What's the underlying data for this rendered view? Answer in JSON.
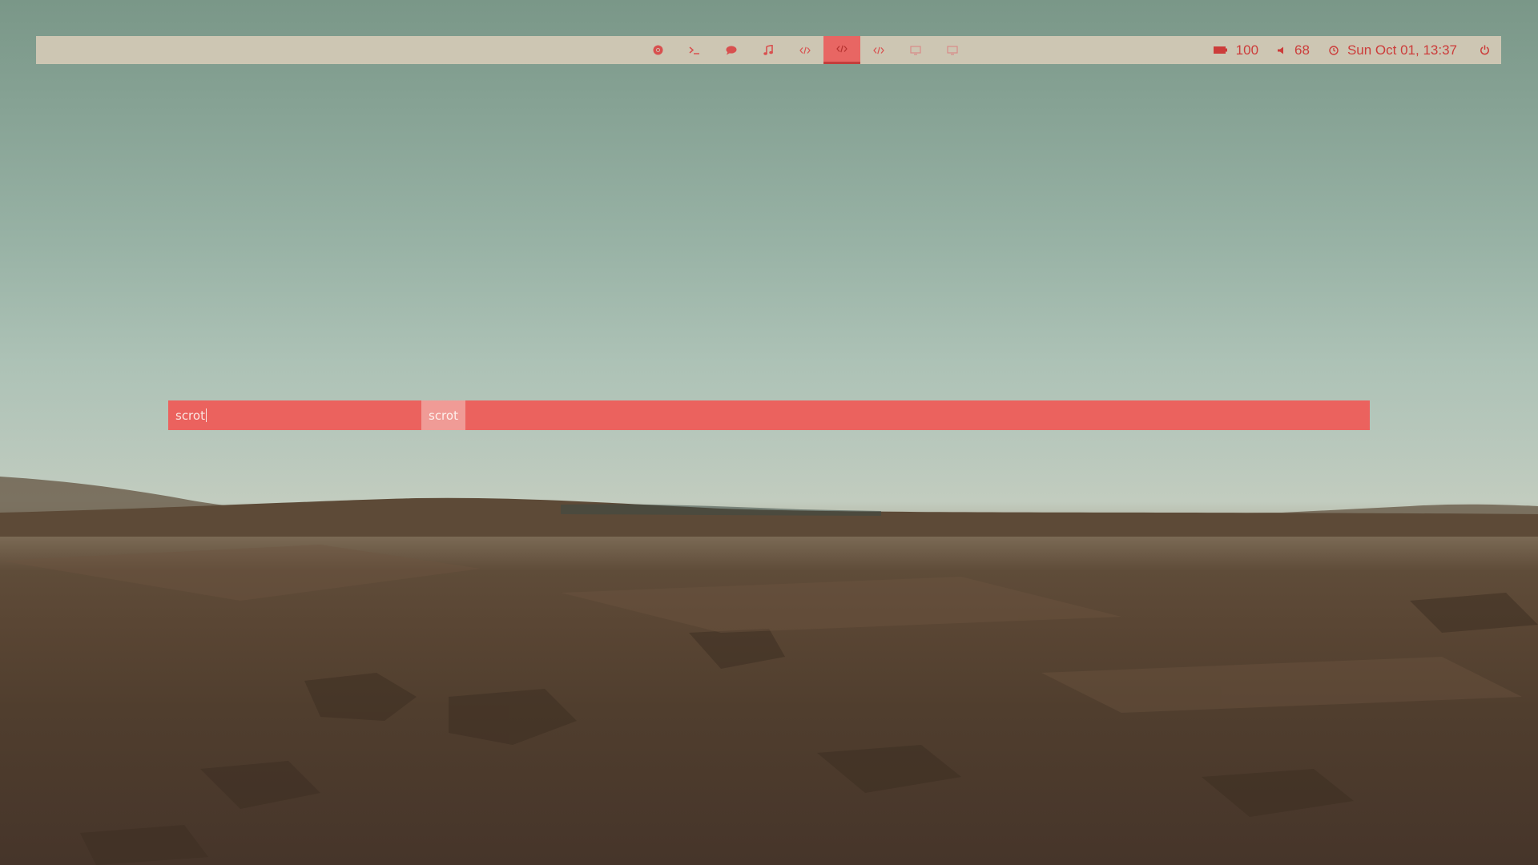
{
  "colors": {
    "bar_bg": "#cdc6b3",
    "accent": "#e86663",
    "text": "#cc3c3a",
    "launcher_bg": "#eb625e",
    "launcher_selected": "#f09b96"
  },
  "workspaces": [
    {
      "icon": "chrome-icon",
      "active": false
    },
    {
      "icon": "terminal-icon",
      "active": false
    },
    {
      "icon": "chat-icon",
      "active": false
    },
    {
      "icon": "music-icon",
      "active": false
    },
    {
      "icon": "code-icon",
      "active": false
    },
    {
      "icon": "code-icon",
      "active": true
    },
    {
      "icon": "code-icon",
      "active": false
    },
    {
      "icon": "monitor-icon",
      "active": false
    },
    {
      "icon": "monitor-icon",
      "active": false
    }
  ],
  "status": {
    "battery": "100",
    "volume": "68",
    "datetime": "Sun Oct 01, 13:37"
  },
  "launcher": {
    "input": "scrot",
    "results": [
      "scrot"
    ]
  }
}
